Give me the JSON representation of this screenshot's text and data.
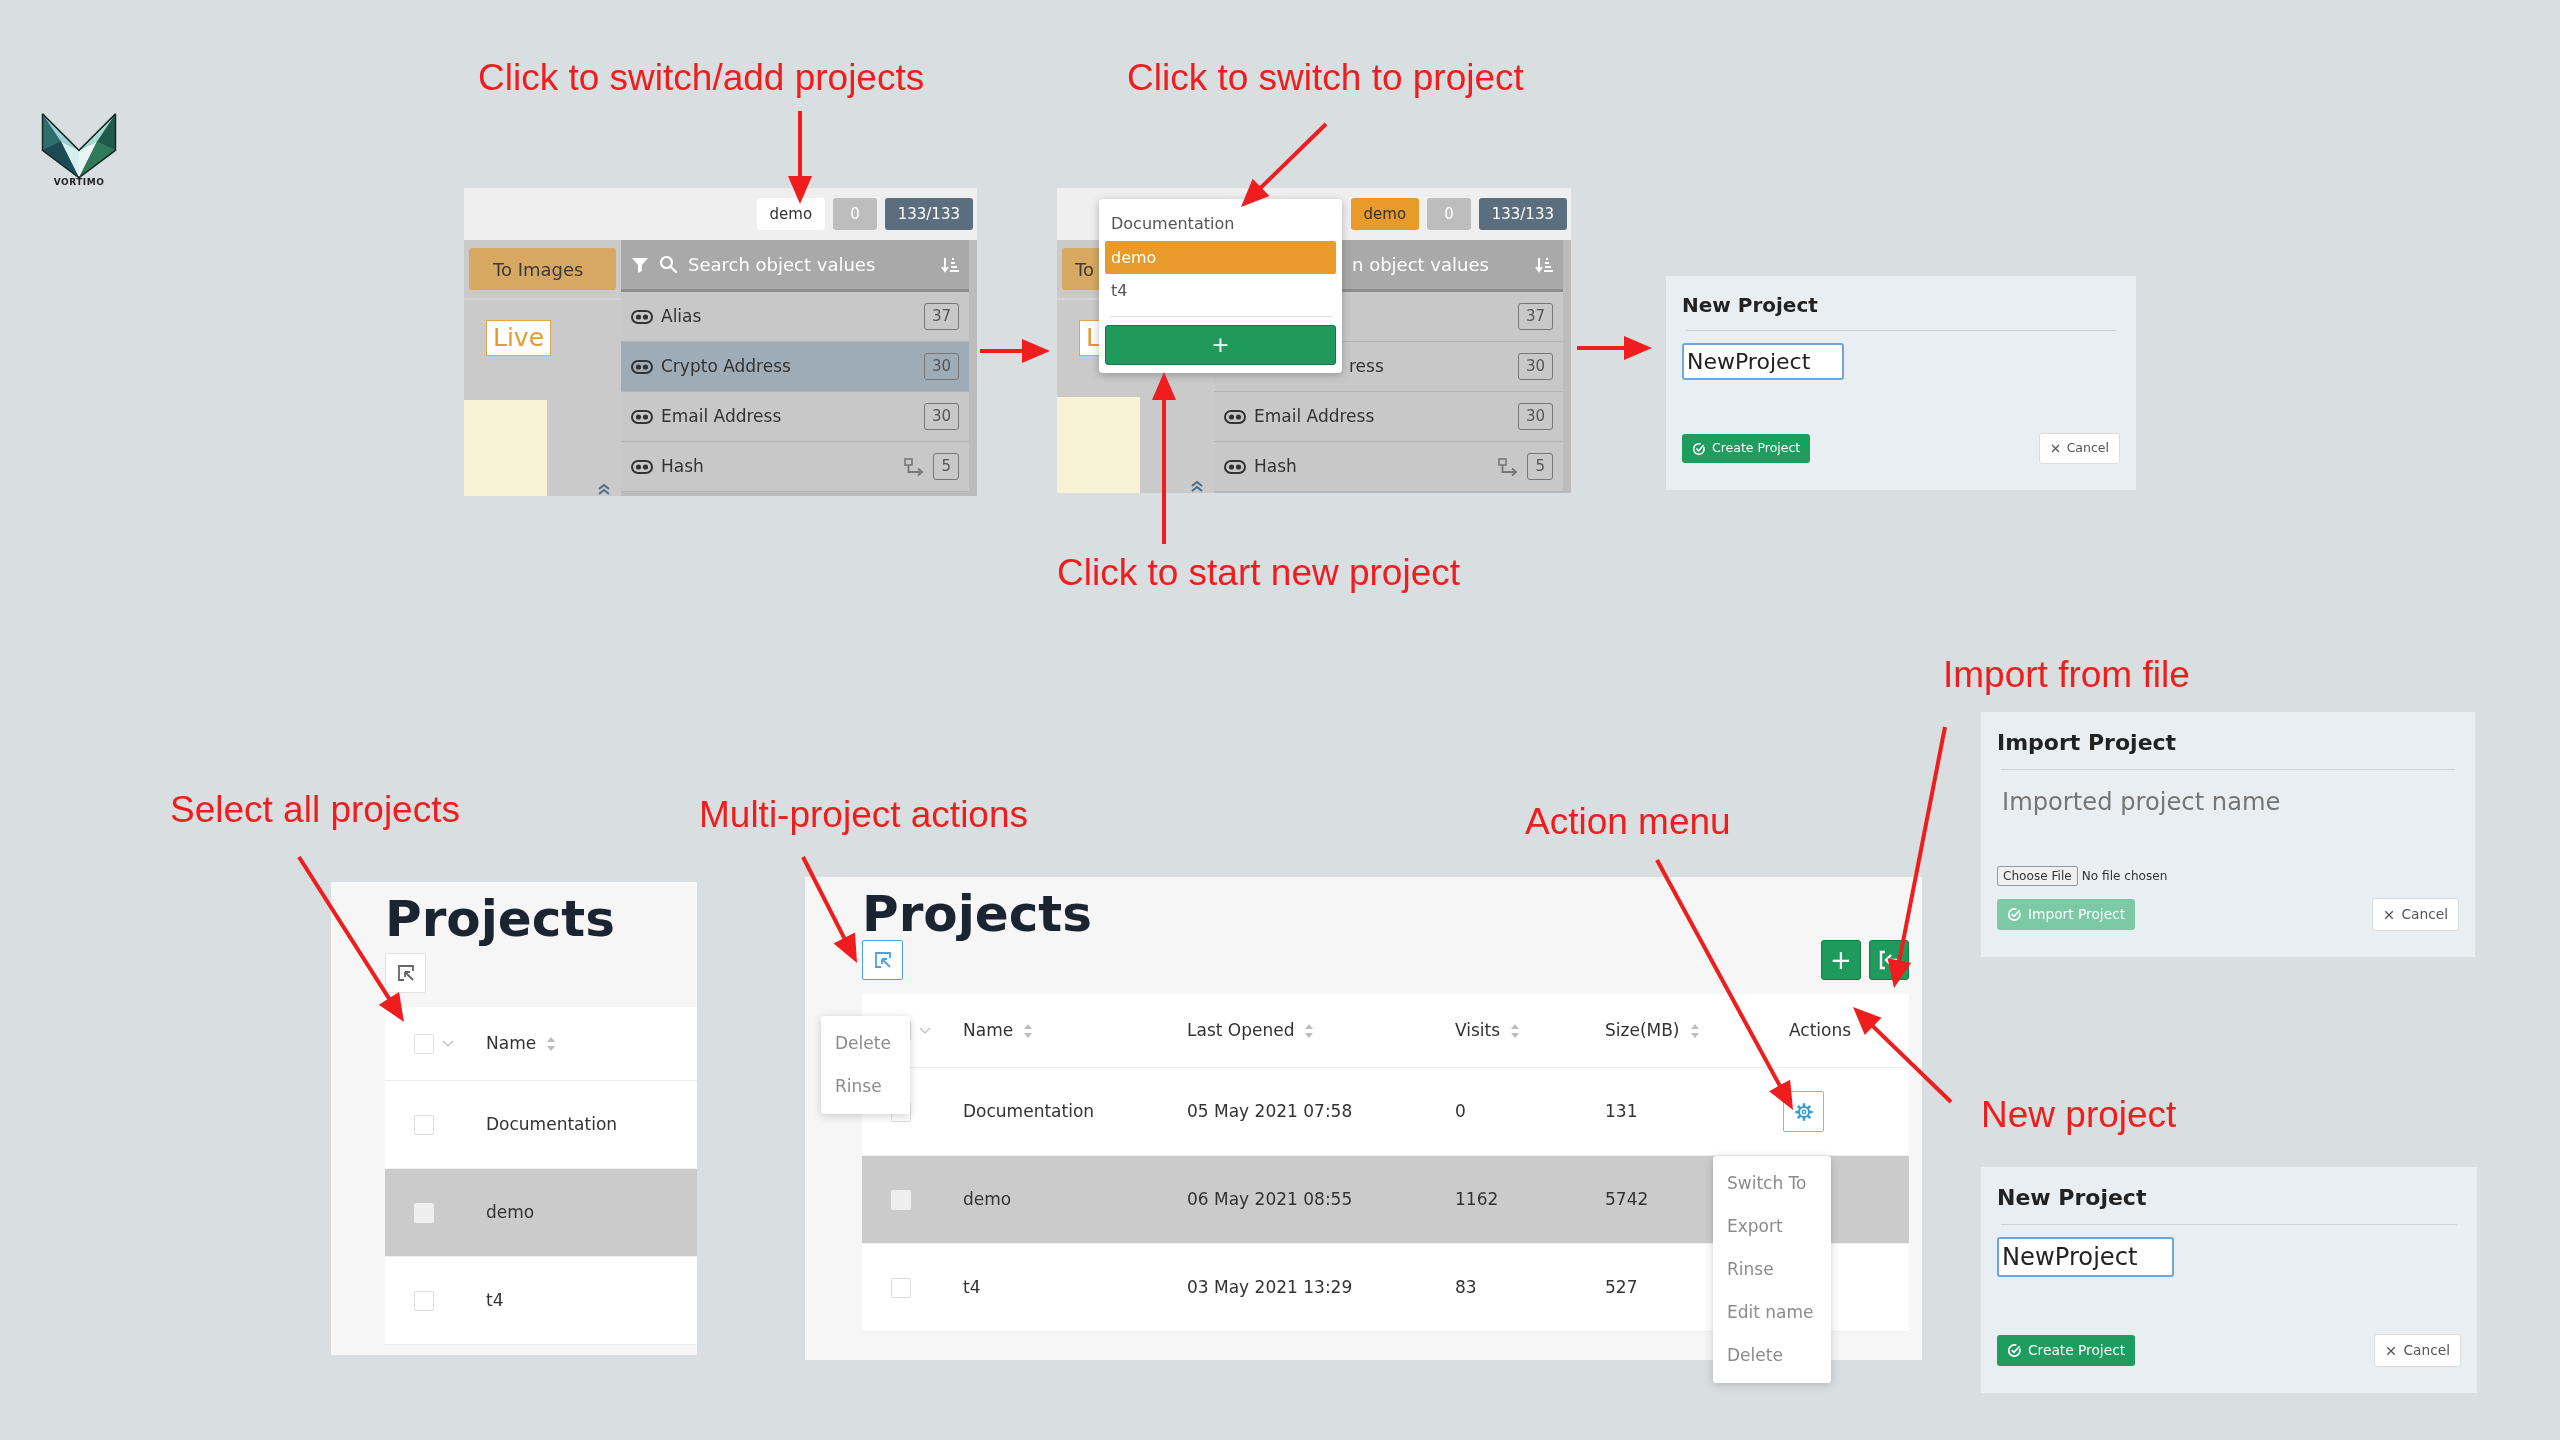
{
  "logo": {
    "text": "VORTIMO"
  },
  "callouts": [
    {
      "text": "Click to switch/add projects"
    },
    {
      "text": "Click to switch to project"
    },
    {
      "text": "Click to start new project"
    },
    {
      "text": "Select all projects"
    },
    {
      "text": "Multi-project actions"
    },
    {
      "text": "Action menu"
    },
    {
      "text": "Import from file"
    },
    {
      "text": "New project"
    }
  ],
  "panels": [
    {
      "kind": "workspace",
      "project": "demo",
      "project_menu_open": false,
      "counter": "0",
      "total": "133/133",
      "to_images": "To Images",
      "live": "Live",
      "search_placeholder": "Search object values",
      "items": [
        {
          "label": "Alias",
          "count": "37",
          "selected": false,
          "linked": false
        },
        {
          "label": "Crypto Address",
          "count": "30",
          "selected": true,
          "linked": false
        },
        {
          "label": "Email Address",
          "count": "30",
          "selected": false,
          "linked": false
        },
        {
          "label": "Hash",
          "count": "5",
          "selected": false,
          "linked": true
        }
      ]
    },
    {
      "kind": "workspace",
      "project": "demo",
      "project_menu_open": true,
      "counter": "0",
      "total": "133/133",
      "to_images": "To",
      "live": "L",
      "search_placeholder": "n object values",
      "items": [
        {
          "count": "37",
          "selected": false,
          "linked": false
        },
        {
          "label": "ress",
          "count": "30",
          "selected": false,
          "linked": false
        },
        {
          "label": "Email Address",
          "count": "30",
          "selected": false,
          "linked": false
        },
        {
          "label": "Hash",
          "count": "5",
          "selected": false,
          "linked": true
        }
      ],
      "project_menu": {
        "items": [
          {
            "label": "Documentation",
            "selected": false
          },
          {
            "label": "demo",
            "selected": true
          },
          {
            "label": "t4",
            "selected": false
          }
        ],
        "add_button": "+"
      }
    },
    {
      "kind": "form",
      "title": "New Project",
      "name_value": "NewProject",
      "focused": true,
      "submit": "Create Project",
      "submit_disabled": false,
      "cancel": "Cancel"
    },
    {
      "kind": "project_table",
      "title": "Projects",
      "select_mode": false,
      "header_checked": false,
      "columns": [
        {
          "label": "Name",
          "sortable": true
        }
      ],
      "rows": [
        {
          "cells": [
            "Documentation"
          ],
          "selected": false,
          "checked": false
        },
        {
          "cells": [
            "demo"
          ],
          "selected": true,
          "checked": false
        },
        {
          "cells": [
            "t4"
          ],
          "selected": false,
          "checked": false
        }
      ]
    },
    {
      "kind": "project_table",
      "title": "Projects",
      "select_mode": true,
      "header_checked": false,
      "bulk_menu": {
        "items": [
          "Delete",
          "Rinse"
        ]
      },
      "buttons": [
        {
          "kind": "add",
          "text": "+"
        },
        {
          "kind": "import"
        }
      ],
      "columns": [
        {
          "label": "Name",
          "sortable": true
        },
        {
          "label": "Last Opened",
          "sortable": true
        },
        {
          "label": "Visits",
          "sortable": true
        },
        {
          "label": "Size(MB)",
          "sortable": true
        },
        {
          "label": "Actions",
          "sortable": false
        }
      ],
      "rows": [
        {
          "cells": [
            "Documentation",
            "05 May 2021 07:58",
            "0",
            "131"
          ],
          "selected": false,
          "checked": false,
          "action_button": true
        },
        {
          "cells": [
            "demo",
            "06 May 2021 08:55",
            "1162",
            "5742"
          ],
          "selected": true,
          "checked": false
        },
        {
          "cells": [
            "t4",
            "03 May 2021 13:29",
            "83",
            "527"
          ],
          "selected": false,
          "checked": false
        }
      ],
      "action_menu": {
        "items": [
          "Switch To",
          "Export",
          "Rinse",
          "Edit name",
          "Delete"
        ]
      }
    },
    {
      "kind": "form",
      "title": "Import Project",
      "name_placeholder": "Imported project name",
      "focused": false,
      "file_button": "Choose File",
      "file_status": "No file chosen",
      "submit": "Import Project",
      "submit_disabled": true,
      "cancel": "Cancel"
    },
    {
      "kind": "form",
      "title": "New Project",
      "name_value": "NewProject",
      "focused": true,
      "submit": "Create Project",
      "submit_disabled": false,
      "cancel": "Cancel"
    }
  ]
}
